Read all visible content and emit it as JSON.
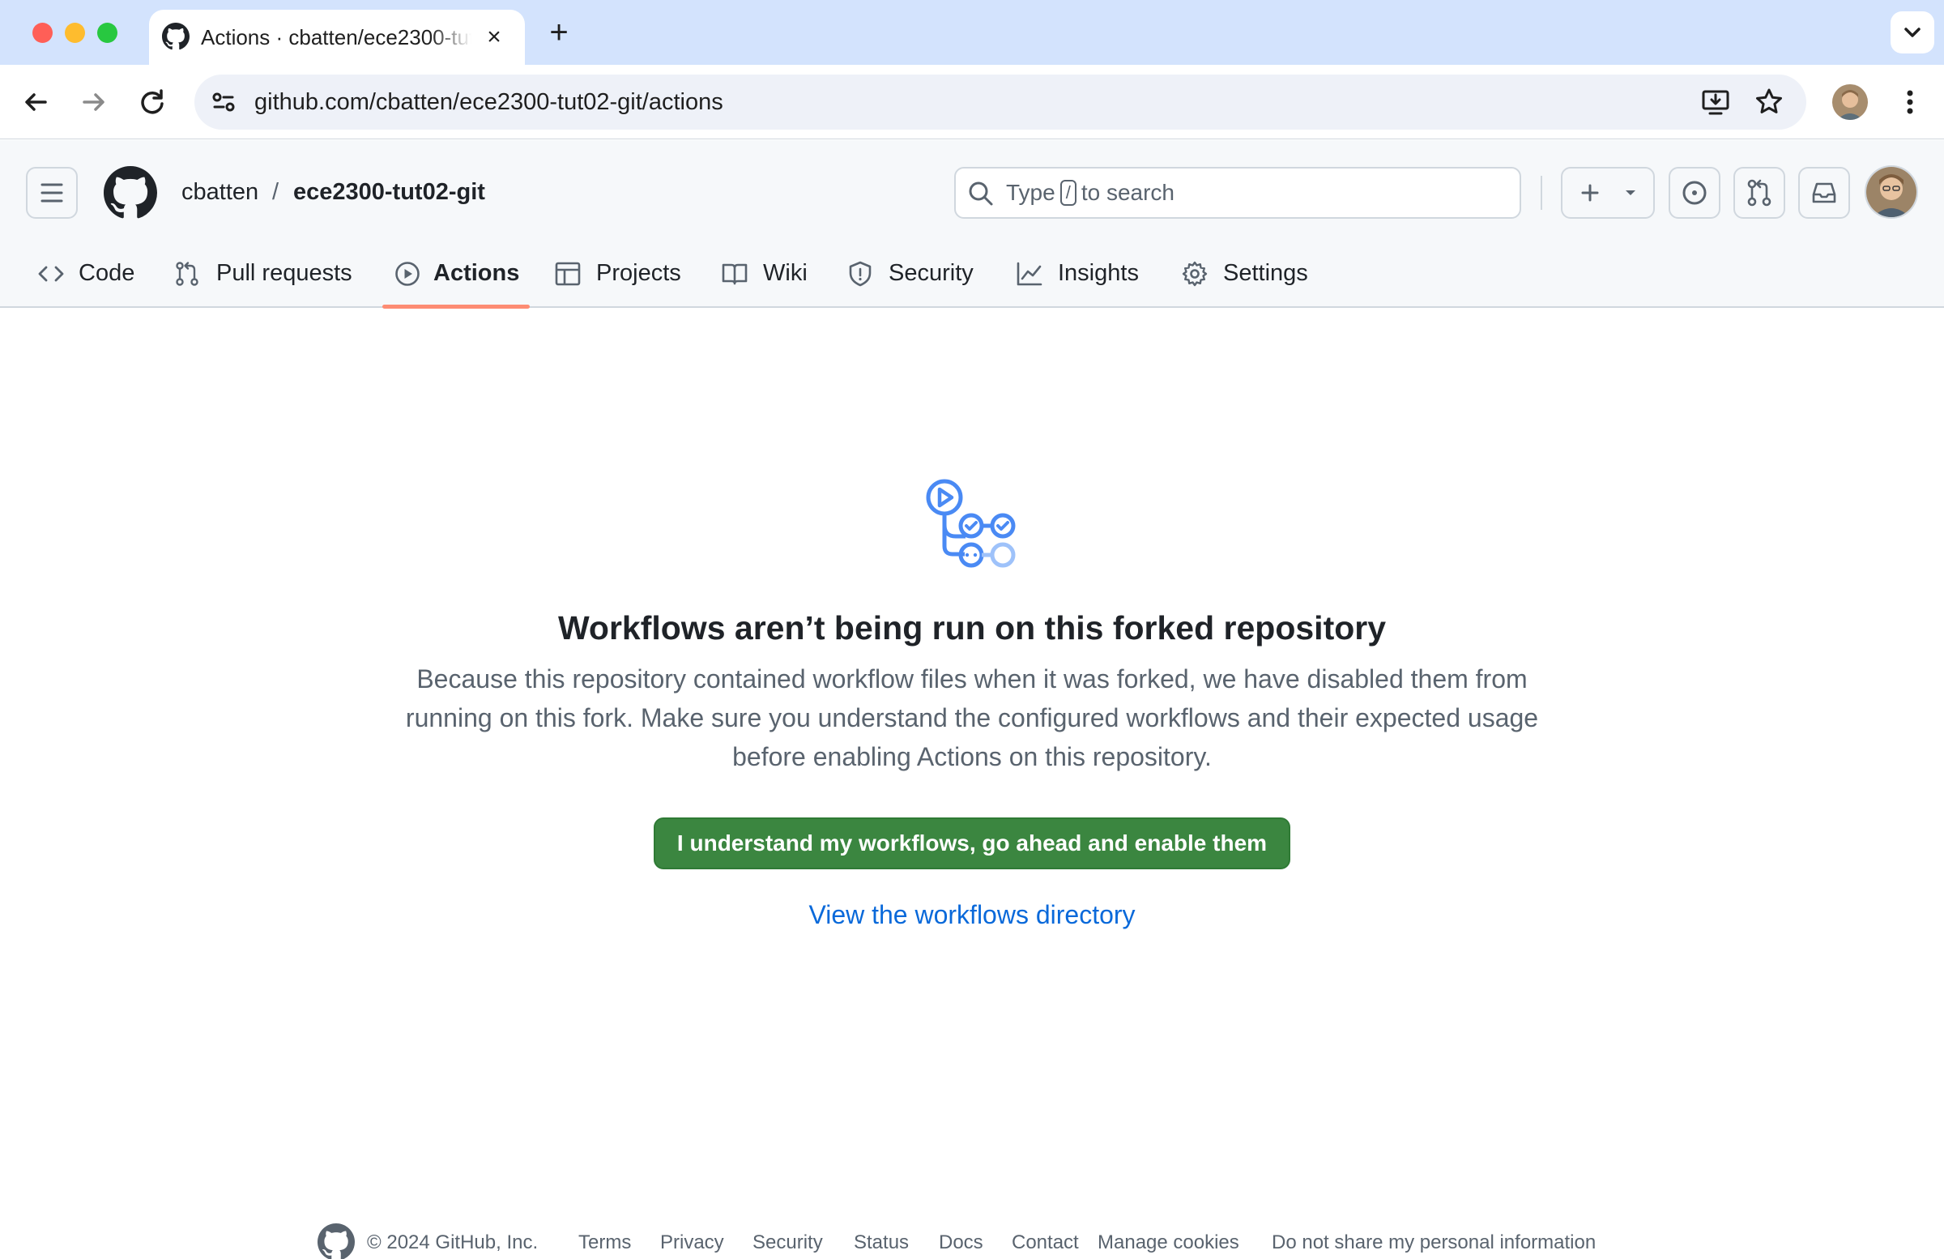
{
  "browser": {
    "tab_title": "Actions · cbatten/ece2300-tut02-git",
    "tab_close": "×",
    "new_tab": "+",
    "url": "github.com/cbatten/ece2300-tut02-git/actions"
  },
  "header": {
    "owner": "cbatten",
    "separator": "/",
    "repo": "ece2300-tut02-git",
    "search": {
      "prefix": "Type",
      "key": "/",
      "suffix": "to search"
    }
  },
  "repo_nav": {
    "tabs": [
      {
        "label": "Code",
        "icon": "code-icon"
      },
      {
        "label": "Pull requests",
        "icon": "git-pull-request-icon"
      },
      {
        "label": "Actions",
        "icon": "play-icon",
        "active": true
      },
      {
        "label": "Projects",
        "icon": "table-icon"
      },
      {
        "label": "Wiki",
        "icon": "book-icon"
      },
      {
        "label": "Security",
        "icon": "shield-icon"
      },
      {
        "label": "Insights",
        "icon": "graph-icon"
      },
      {
        "label": "Settings",
        "icon": "gear-icon"
      }
    ]
  },
  "main": {
    "title": "Workflows aren’t being run on this forked repository",
    "description": "Because this repository contained workflow files when it was forked, we have disabled them from running on this fork. Make sure you understand the configured workflows and their expected usage before enabling Actions on this repository.",
    "enable_button": "I understand my workflows, go ahead and enable them",
    "directory_link": "View the workflows directory"
  },
  "footer": {
    "copyright": "© 2024 GitHub, Inc.",
    "links": [
      "Terms",
      "Privacy",
      "Security",
      "Status",
      "Docs",
      "Contact",
      "Manage cookies",
      "Do not share my personal information"
    ]
  },
  "colors": {
    "accent_blue": "#0969da",
    "primary_green": "#3b8640",
    "active_tab_underline": "#fd8c73",
    "workflow_icon_blue": "#4a8af4"
  }
}
